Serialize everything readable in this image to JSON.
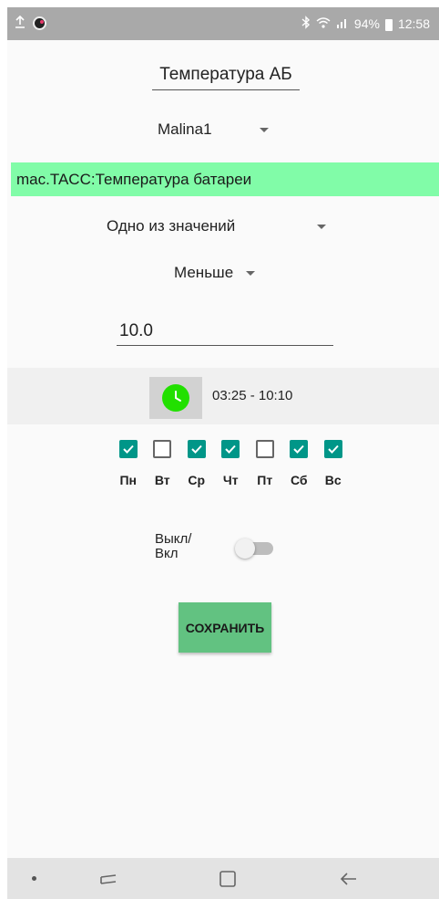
{
  "status_bar": {
    "battery": "94%",
    "time": "12:58",
    "icons": [
      "upload-icon",
      "app-notification-icon",
      "bluetooth-icon",
      "wifi-icon",
      "signal-icon",
      "battery-icon"
    ]
  },
  "form": {
    "title": "Температура АБ",
    "device": "Malina1",
    "sensor": "mac.TACC:Температура батареи",
    "condition": "Одно из значений",
    "comparison": "Меньше",
    "threshold": "10.0",
    "time_range": "03:25 - 10:10",
    "days": [
      {
        "label": "Пн",
        "checked": true
      },
      {
        "label": "Вт",
        "checked": false
      },
      {
        "label": "Ср",
        "checked": true
      },
      {
        "label": "Чт",
        "checked": true
      },
      {
        "label": "Пт",
        "checked": false
      },
      {
        "label": "Сб",
        "checked": true
      },
      {
        "label": "Вс",
        "checked": true
      }
    ],
    "toggle_label_line1": "Выкл/",
    "toggle_label_line2": "Вкл",
    "toggle_on": false,
    "save_label": "СОХРАНИТЬ"
  },
  "colors": {
    "sensor_banner": "#81fca8",
    "checkbox_checked": "#009688",
    "save_button": "#62c281",
    "clock_icon": "#22e000"
  }
}
